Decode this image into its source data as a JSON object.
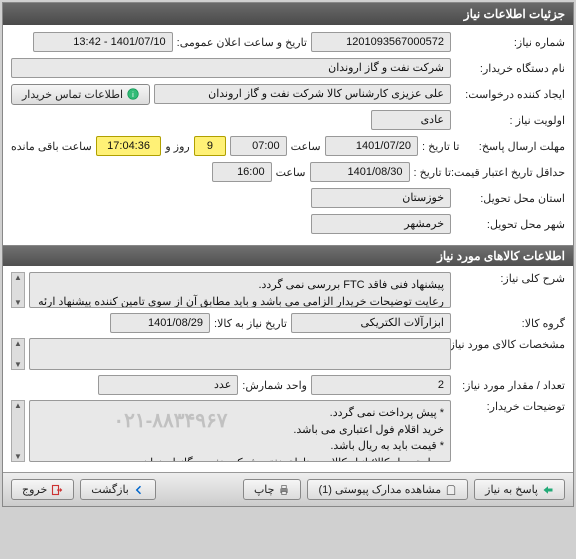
{
  "window": {
    "title": "جزئیات اطلاعات نیاز"
  },
  "section1": {
    "labels": {
      "need_no": "شماره نیاز:",
      "announce_dt": "تاریخ و ساعت اعلان عمومی:",
      "buyer_org": "نام دستگاه خریدار:",
      "requester": "ایجاد کننده درخواست:",
      "contact_btn": "اطلاعات تماس خریدار",
      "priority": "اولویت نیاز :",
      "reply_deadline": "مهلت ارسال پاسخ:",
      "to_date1": "تا تاریخ :",
      "time1": "ساعت",
      "days_and": "روز و",
      "time_remain": "ساعت باقی مانده",
      "price_validity": "حداقل تاریخ اعتبار قیمت:",
      "to_date2": "تا تاریخ :",
      "time2": "ساعت",
      "delivery_province": "استان محل تحویل:",
      "delivery_city": "شهر محل تحویل:"
    },
    "values": {
      "need_no": "1201093567000572",
      "announce_dt": "1401/07/10 - 13:42",
      "buyer_org": "شرکت نفت و گاز اروندان",
      "requester": "علی عزیزی کارشناس کالا شرکت نفت و گاز اروندان",
      "priority": "عادی",
      "deadline_date": "1401/07/20",
      "deadline_time": "07:00",
      "days_remaining": "9",
      "countdown": "17:04:36",
      "validity_date": "1401/08/30",
      "validity_time": "16:00",
      "province": "خوزستان",
      "city": "خرمشهر"
    }
  },
  "section2": {
    "header": "اطلاعات کالاهای مورد نیاز",
    "labels": {
      "need_desc": "شرح کلی نیاز:",
      "goods_group": "گروه کالا:",
      "need_date_goods": "تاریخ نیاز به کالا:",
      "goods_spec": "مشخصات کالای مورد نیاز:",
      "qty": "تعداد / مقدار مورد نیاز:",
      "unit": "واحد شمارش:",
      "buyer_notes": "توضیحات خریدار:"
    },
    "values": {
      "need_desc": "پیشنهاد فنی فاقد FTC بررسی نمی گردد.\nرعایت توضیحات خریدار الزامی می باشد و باید مطابق آن از سوی تامین کننده پیشنهاد ارئه گردد.",
      "goods_group": "ابزارآلات الکتریکی",
      "need_date_goods": "1401/08/29",
      "goods_spec": "",
      "qty": "2",
      "unit": "عدد",
      "buyer_notes": "* پیش پرداخت نمی گردد.\nخرید اقلام فول اعتباری می باشد.\n* قیمت باید به ریال باشد.\nمحل تحویل کالا؛ انبار کالا در مناطق نفتی شرکت نفت و گاز اروندان."
    },
    "watermark": "۰۲۱-۸۸۳۴۹۶۷"
  },
  "footer": {
    "reply": "پاسخ به نیاز",
    "attachments": "مشاهده مدارک پیوستی (1)",
    "print": "چاپ",
    "back": "بازگشت",
    "exit": "خروج"
  }
}
